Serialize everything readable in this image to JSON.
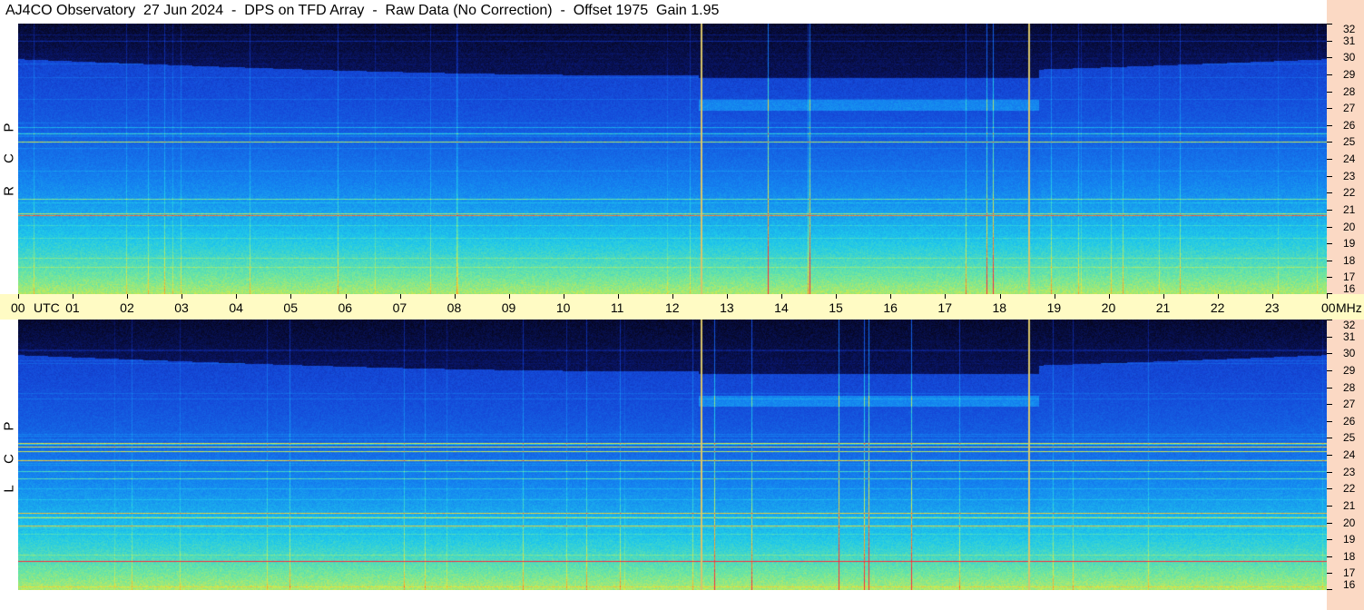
{
  "title": "AJ4CO Observatory  27 Jun 2024  -  DPS on TFD Array  -  Raw Data (No Correction)  -  Offset 1975  Gain 1.95",
  "panels": [
    {
      "name": "rcp",
      "letters": [
        "R",
        "C",
        "P"
      ]
    },
    {
      "name": "lcp",
      "letters": [
        "L",
        "C",
        "P"
      ]
    }
  ],
  "time_axis": {
    "labels": [
      "00",
      "01",
      "02",
      "03",
      "04",
      "05",
      "06",
      "07",
      "08",
      "09",
      "10",
      "11",
      "12",
      "13",
      "14",
      "15",
      "16",
      "17",
      "18",
      "19",
      "20",
      "21",
      "22",
      "23",
      "00"
    ],
    "utc_label": "UTC",
    "mhz_label": "MHz"
  },
  "freq_axis": {
    "labels": [
      "32",
      "31",
      "30",
      "29",
      "28",
      "27",
      "26",
      "25",
      "24",
      "23",
      "22",
      "21",
      "20",
      "19",
      "18",
      "17",
      "16"
    ]
  },
  "colors": {
    "background": "#ffffff",
    "time_axis_bg": "#fffbc4",
    "freq_axis_bg": "#fbd9c4",
    "marker_line": "#d8c46a",
    "spectrogram_low": "#05051a",
    "spectrogram_mid": "#1a4fd6",
    "spectrogram_high": "#ff3030"
  }
}
